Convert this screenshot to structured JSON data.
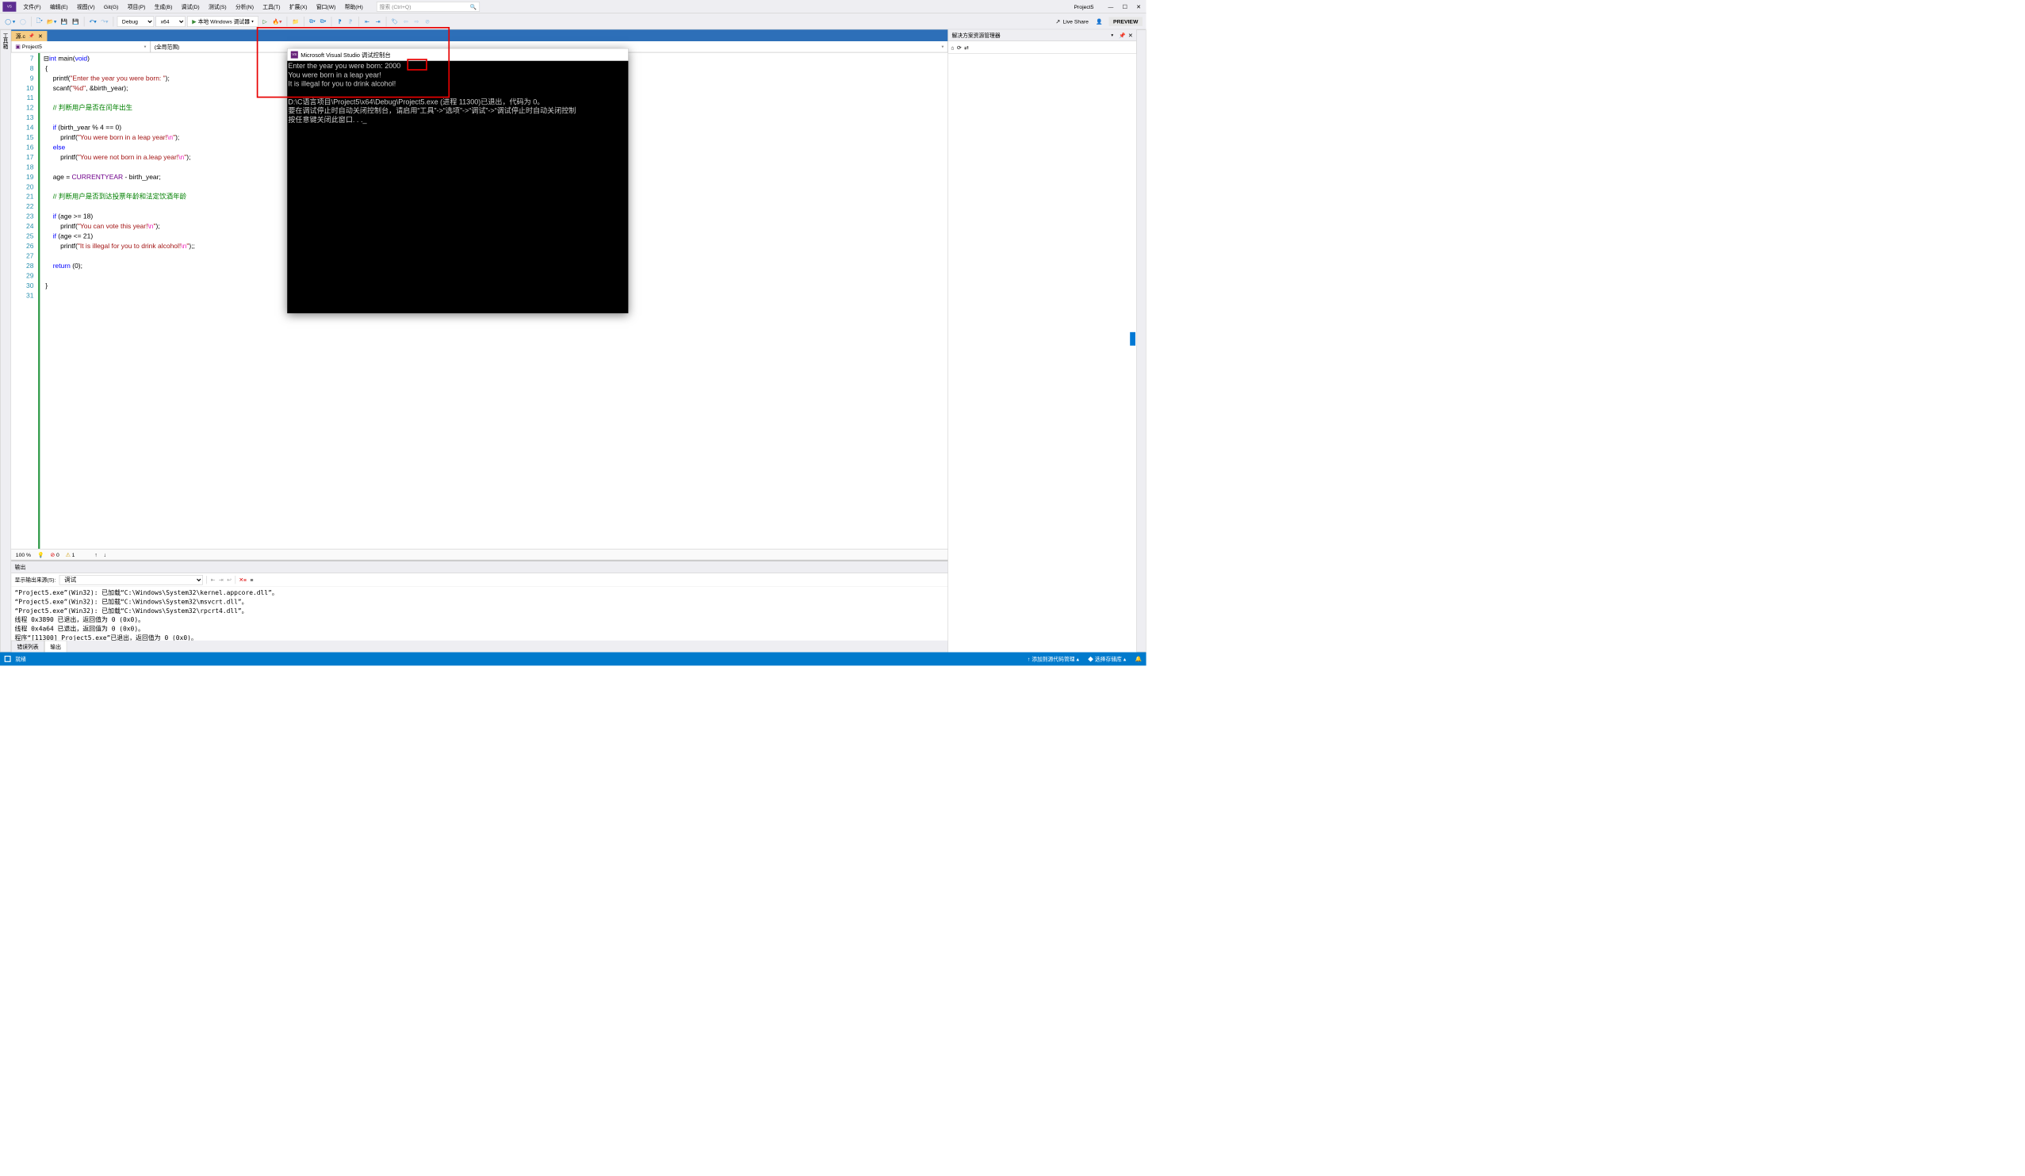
{
  "titlebar": {
    "menus": [
      "文件(F)",
      "编辑(E)",
      "视图(V)",
      "Git(G)",
      "项目(P)",
      "生成(B)",
      "调试(D)",
      "测试(S)",
      "分析(N)",
      "工具(T)",
      "扩展(X)",
      "窗口(W)",
      "帮助(H)"
    ],
    "search_placeholder": "搜索 (Ctrl+Q)",
    "project_name": "Project5"
  },
  "toolbar": {
    "config": "Debug",
    "platform": "x64",
    "run_label": "本地 Windows 调试器",
    "live_share": "Live Share",
    "preview": "PREVIEW"
  },
  "side_tab": "工具箱",
  "editor": {
    "tab_name": "源.c",
    "scope_project": "Project5",
    "scope_func": "(全局范围)",
    "zoom": "100 %",
    "errors": "0",
    "warnings": "1",
    "line_start": 7,
    "line_end": 31
  },
  "code_lines": [
    {
      "n": 7,
      "raw": ""
    },
    {
      "n": 8,
      "html": "<span class='ty'>int</span> <span class='fn'>main</span>(<span class='ty'>void</span>)"
    },
    {
      "n": 9,
      "html": "{"
    },
    {
      "n": 10,
      "html": "    <span class='fn'>printf</span>(<span class='str'>\"Enter the year you were born: \"</span>);"
    },
    {
      "n": 11,
      "html": "    <span class='fn'>scanf</span>(<span class='str'>\"%d\"</span>, &amp;birth_year);"
    },
    {
      "n": 12,
      "html": ""
    },
    {
      "n": 13,
      "html": "    <span class='cm'>// 判断用户是否在闰年出生</span>"
    },
    {
      "n": 14,
      "html": ""
    },
    {
      "n": 15,
      "html": "    <span class='kw'>if</span> (birth_year % 4 == 0)"
    },
    {
      "n": 16,
      "html": "        <span class='fn'>printf</span>(<span class='str'>\"You were born in a leap year!</span><span class='esc'>\\n</span><span class='str'>\"</span>);"
    },
    {
      "n": 17,
      "html": "    <span class='kw'>else</span>"
    },
    {
      "n": 18,
      "html": "        <span class='fn'>printf</span>(<span class='str'>\"You were not born in a.leap year!</span><span class='esc'>\\n</span><span class='str'>\"</span>);"
    },
    {
      "n": 19,
      "html": ""
    },
    {
      "n": 20,
      "html": "    age = <span class='mc'>CURRENTYEAR</span> - birth_year;"
    },
    {
      "n": 21,
      "html": ""
    },
    {
      "n": 22,
      "html": "    <span class='cm'>// 判断用户是否到达投票年龄和法定饮酒年龄</span>"
    },
    {
      "n": 23,
      "html": ""
    },
    {
      "n": 24,
      "html": "    <span class='kw'>if</span> (age &gt;= 18)"
    },
    {
      "n": 25,
      "html": "        <span class='fn'>printf</span>(<span class='str'>\"You can vote this year!</span><span class='esc'>\\n</span><span class='str'>\"</span>);"
    },
    {
      "n": 26,
      "html": "    <span class='kw'>if</span> (age &lt;= 21)"
    },
    {
      "n": 27,
      "html": "        <span class='fn'>printf</span>(<span class='str'>\"It is illegal for you to drink alcohol!</span><span class='esc'>\\n</span><span class='str'>\"</span>);;"
    },
    {
      "n": 28,
      "html": ""
    },
    {
      "n": 29,
      "html": "    <span class='kw'>return</span> (0);"
    },
    {
      "n": 30,
      "html": ""
    },
    {
      "n": 31,
      "html": "}"
    }
  ],
  "output": {
    "title": "输出",
    "source_label": "显示输出来源(S):",
    "source_value": "调试",
    "lines": [
      "“Project5.exe”(Win32): 已加载“C:\\Windows\\System32\\kernel.appcore.dll”。",
      "“Project5.exe”(Win32): 已加载“C:\\Windows\\System32\\msvcrt.dll”。",
      "“Project5.exe”(Win32): 已加载“C:\\Windows\\System32\\rpcrt4.dll”。",
      "线程 0x3890 已退出，返回值为 0 (0x0)。",
      "线程 0x4a64 已退出，返回值为 0 (0x0)。",
      "程序“[11300] Project5.exe”已退出，返回值为 0 (0x0)。"
    ]
  },
  "bottom_tabs": {
    "errors": "错误列表",
    "output": "输出"
  },
  "right_panel": {
    "title": "解决方案资源管理器"
  },
  "console": {
    "title": "Microsoft Visual Studio 调试控制台",
    "lines": [
      "Enter the year you were born: 2000",
      "You were born in a leap year!",
      "It is illegal for you to drink alcohol!",
      "",
      "D:\\C语言项目\\Project5\\x64\\Debug\\Project5.exe (进程 11300)已退出，代码为 0。",
      "要在调试停止时自动关闭控制台，请启用“工具”->“选项”->“调试”->“调试停止时自动关闭控制",
      "按任意键关闭此窗口. . ._"
    ]
  },
  "statusbar": {
    "ready": "就绪",
    "add_source": "添加到源代码管理",
    "select_repo": "选择存储库"
  }
}
